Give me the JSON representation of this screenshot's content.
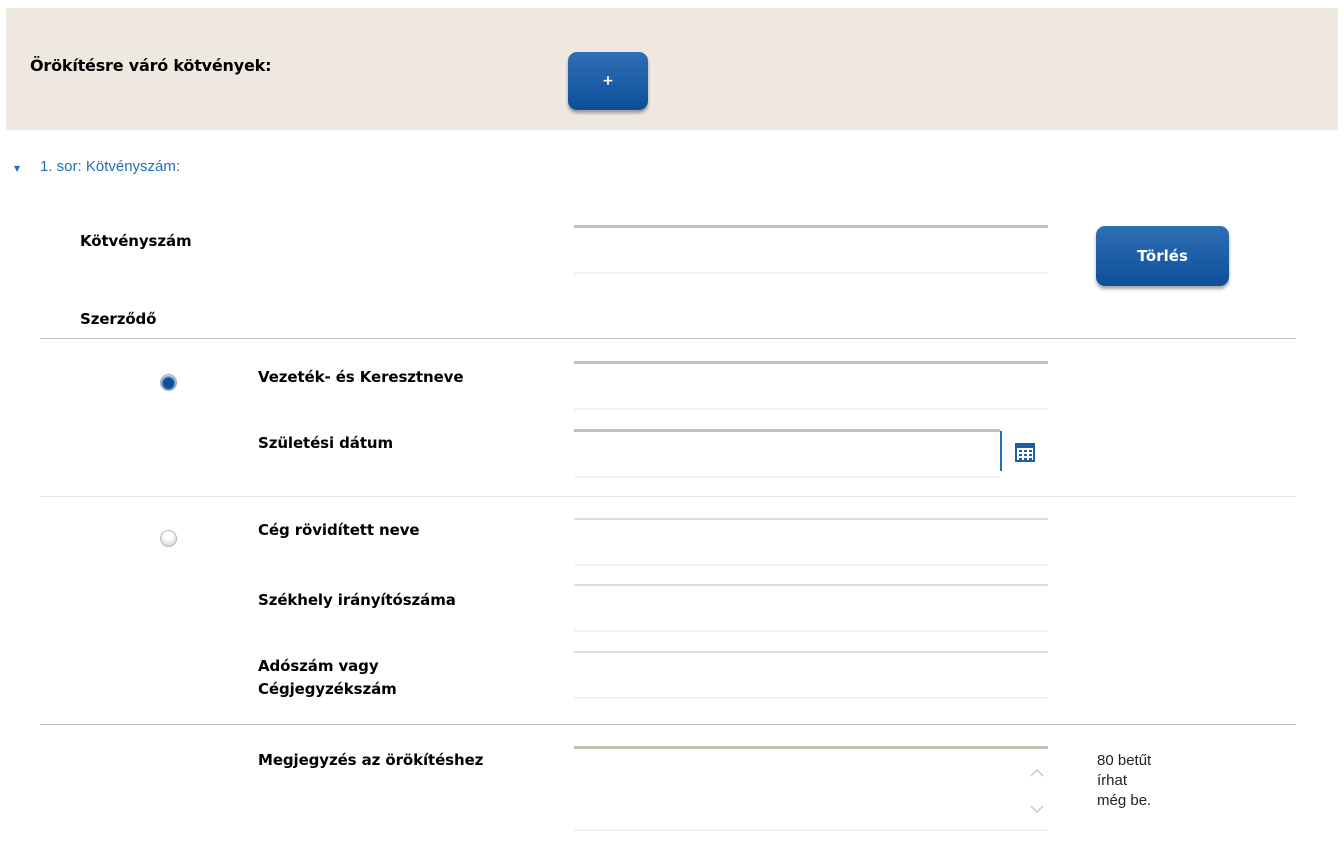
{
  "header": {
    "title": "Örökítésre váró kötvények:",
    "add_button": "+"
  },
  "row": {
    "caret": "▼",
    "link": "1. sor: Kötvényszám:"
  },
  "policy": {
    "label": "Kötvényszám",
    "value": "",
    "delete_button": "Törlés"
  },
  "contract": {
    "label": "Szerződő"
  },
  "person": {
    "selected": true,
    "name_label": "Vezeték- és Keresztneve",
    "name_value": "",
    "birth_label": "Születési dátum",
    "birth_value": ""
  },
  "company": {
    "selected": false,
    "name_label": "Cég rövidített neve",
    "zip_label": "Székhely irányítószáma",
    "tax_label_line1": "Adószám vagy",
    "tax_label_line2": "Cégjegyzékszám"
  },
  "note": {
    "label": "Megjegyzés az örökítéshez",
    "value": "",
    "counter_line1": "80 betűt",
    "counter_line2": "írhat",
    "counter_line3": "még be."
  }
}
